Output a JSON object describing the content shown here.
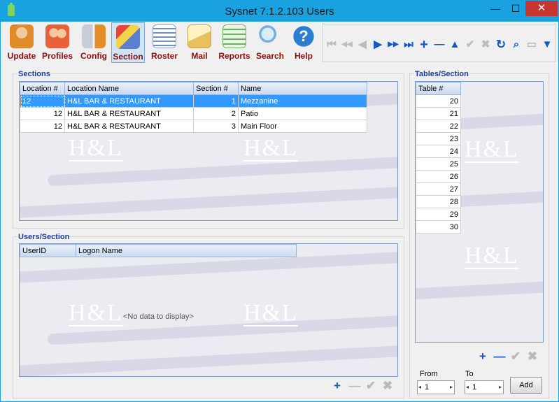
{
  "window": {
    "title": "Sysnet 7.1.2.103 Users",
    "minimize": "—",
    "maximize": "☐",
    "close": "✕"
  },
  "toolbar": {
    "buttons": [
      {
        "label": "Update",
        "icon": "person-update-icon",
        "color": "#e08a2a"
      },
      {
        "label": "Profiles",
        "icon": "people-profiles-icon",
        "color": "#e9603b"
      },
      {
        "label": "Config",
        "icon": "wrench-config-icon",
        "color": "#9aa0aa"
      },
      {
        "label": "Section",
        "icon": "section-icon",
        "color": "#5a7fd0"
      },
      {
        "label": "Roster",
        "icon": "roster-icon",
        "color": "#6f8fc8"
      },
      {
        "label": "Mail",
        "icon": "envelope-icon",
        "color": "#e8c060"
      },
      {
        "label": "Reports",
        "icon": "reports-icon",
        "color": "#6bb35e"
      },
      {
        "label": "Search",
        "icon": "magnifier-icon",
        "color": "#77b0e0"
      },
      {
        "label": "Help",
        "icon": "help-icon",
        "color": "#2a7fd0"
      }
    ],
    "nav": [
      {
        "icon": "first-icon",
        "glyph": "⏮",
        "enabled": false
      },
      {
        "icon": "prev-page-icon",
        "glyph": "◀◀",
        "enabled": false
      },
      {
        "icon": "prev-icon",
        "glyph": "◀",
        "enabled": false
      },
      {
        "icon": "next-icon",
        "glyph": "▶",
        "enabled": true
      },
      {
        "icon": "next-page-icon",
        "glyph": "▶▶",
        "enabled": true
      },
      {
        "icon": "last-icon",
        "glyph": "⏭",
        "enabled": true
      },
      {
        "icon": "add-icon",
        "glyph": "+",
        "enabled": true
      },
      {
        "icon": "remove-icon",
        "glyph": "—",
        "enabled": true
      },
      {
        "icon": "up-icon",
        "glyph": "▲",
        "enabled": true
      },
      {
        "icon": "check-icon",
        "glyph": "✔",
        "enabled": false
      },
      {
        "icon": "cancel-icon",
        "glyph": "✖",
        "enabled": false
      },
      {
        "icon": "refresh-icon",
        "glyph": "↻",
        "enabled": true
      },
      {
        "icon": "bookmark-icon",
        "glyph": "⌕",
        "enabled": true
      },
      {
        "icon": "bookmark-off-icon",
        "glyph": "▭",
        "enabled": false
      },
      {
        "icon": "filter-icon",
        "glyph": "▼",
        "enabled": true
      }
    ]
  },
  "sections": {
    "title": "Sections",
    "columns": [
      "Location #",
      "Location Name",
      "Section #",
      "Name"
    ],
    "rows": [
      {
        "location": "12",
        "location_name": "H&L BAR & RESTAURANT",
        "section": "1",
        "name": "Mezzanine",
        "selected": true
      },
      {
        "location": "12",
        "location_name": "H&L BAR & RESTAURANT",
        "section": "2",
        "name": "Patio",
        "selected": false
      },
      {
        "location": "12",
        "location_name": "H&L BAR & RESTAURANT",
        "section": "3",
        "name": "Main Floor",
        "selected": false
      }
    ]
  },
  "users_section": {
    "title": "Users/Section",
    "columns": [
      "UserID",
      "Logon Name"
    ],
    "empty_text": "<No data to display>"
  },
  "tables_section": {
    "title": "Tables/Section",
    "column": "Table #",
    "rows": [
      "20",
      "21",
      "22",
      "23",
      "24",
      "25",
      "26",
      "27",
      "28",
      "29",
      "30"
    ]
  },
  "range": {
    "from_label": "From",
    "to_label": "To",
    "from_value": "1",
    "to_value": "1",
    "add_label": "Add"
  },
  "watermark": {
    "text": "H&L"
  },
  "colors": {
    "titlebar": "#1aa1e0",
    "accent": "#1b3d9c",
    "selection": "#3399ff",
    "close": "#c7372f"
  }
}
